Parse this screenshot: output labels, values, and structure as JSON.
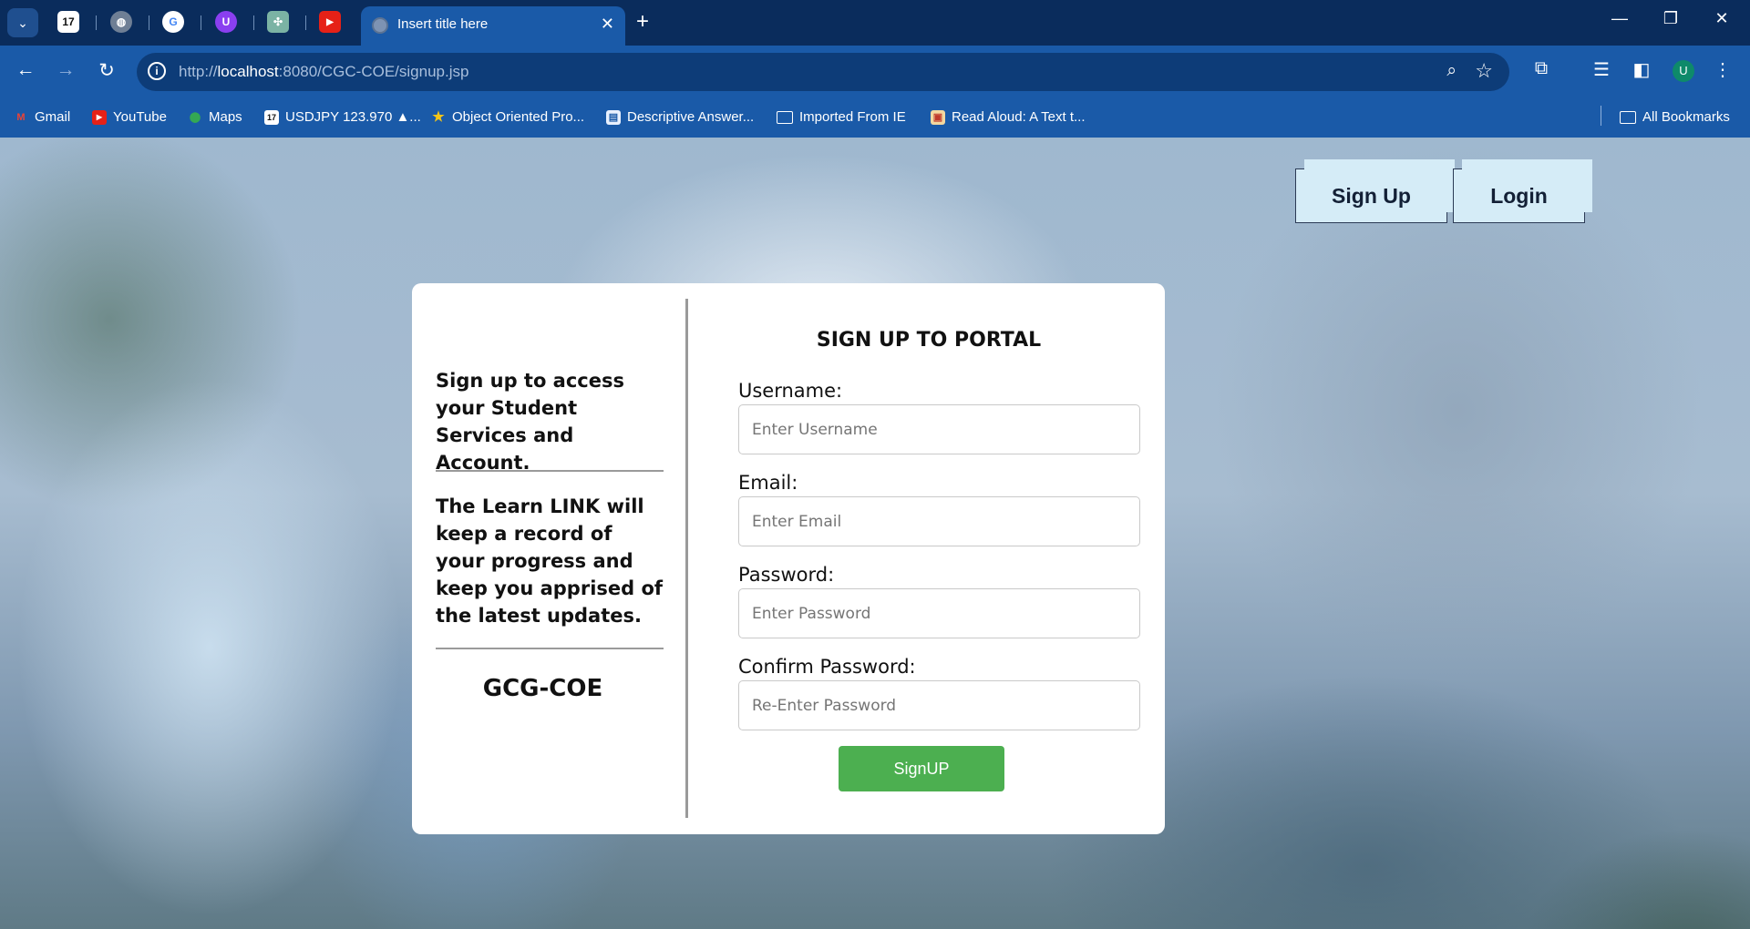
{
  "browser": {
    "active_tab": {
      "title": "Insert title here"
    },
    "pinned_tabs": [
      {
        "icon": "tradingview-icon",
        "glyph": "17"
      },
      {
        "icon": "globe-icon",
        "glyph": "◍"
      },
      {
        "icon": "google-icon",
        "glyph": "G"
      },
      {
        "icon": "u-extension-icon",
        "glyph": "U"
      },
      {
        "icon": "chatgpt-icon",
        "glyph": "✣"
      },
      {
        "icon": "youtube-icon",
        "glyph": "▶"
      }
    ],
    "url": {
      "scheme": "http://",
      "host": "localhost",
      "path": ":8080/CGC-COE/signup.jsp"
    },
    "profile_initial": "U",
    "bookmarks": [
      {
        "label": "Gmail",
        "icon": "gmail-icon"
      },
      {
        "label": "YouTube",
        "icon": "youtube-icon"
      },
      {
        "label": "Maps",
        "icon": "maps-icon"
      },
      {
        "label": "USDJPY 123.970 ▲...",
        "icon": "tradingview-icon"
      },
      {
        "label": "Object Oriented Pro...",
        "icon": "star-icon"
      },
      {
        "label": "Descriptive Answer...",
        "icon": "doc-icon"
      },
      {
        "label": "Imported From IE",
        "icon": "folder-icon"
      },
      {
        "label": "Read Aloud: A Text t...",
        "icon": "read-aloud-icon"
      }
    ],
    "all_bookmarks": "All Bookmarks"
  },
  "nav": {
    "signup": "Sign Up",
    "login": "Login"
  },
  "info": {
    "intro": "Sign up to access your Student Services and Account.",
    "record": "The Learn LINK will keep a record of your progress and keep you apprised of the latest updates.",
    "brand": "GCG-COE"
  },
  "form": {
    "title": "SIGN UP TO PORTAL",
    "username": {
      "label": "Username:",
      "placeholder": "Enter Username"
    },
    "email": {
      "label": "Email:",
      "placeholder": "Enter Email"
    },
    "password": {
      "label": "Password:",
      "placeholder": "Enter Password"
    },
    "confirm": {
      "label": "Confirm Password:",
      "placeholder": "Re-Enter Password"
    },
    "submit": "SignUP"
  },
  "colors": {
    "submit": "#4caf50",
    "chrome": "#1a5aa8",
    "nav_button": "#d5ecf7"
  }
}
